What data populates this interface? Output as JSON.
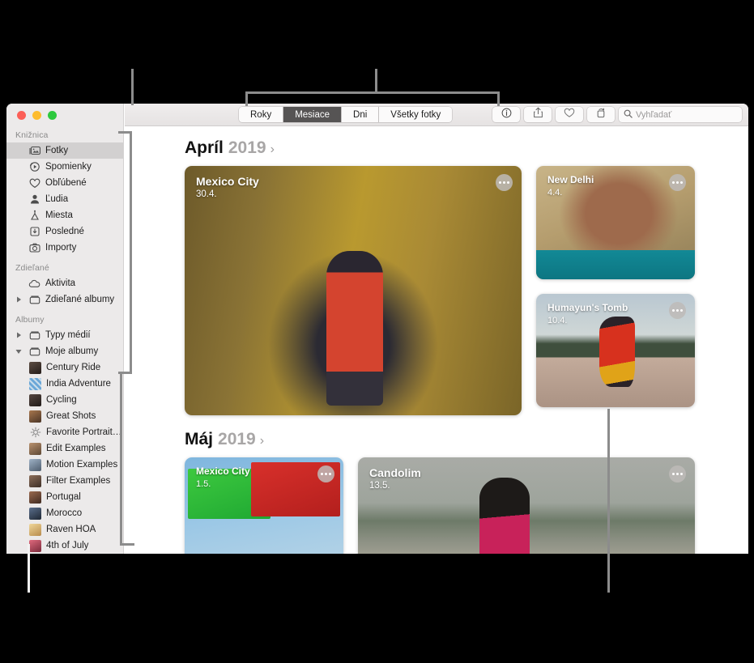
{
  "window": {
    "traffic_lights": [
      "close",
      "minimize",
      "zoom"
    ]
  },
  "sidebar": {
    "sections": [
      {
        "header": "Knižnica",
        "items": [
          {
            "label": "Fotky",
            "icon": "photos-icon",
            "selected": true
          },
          {
            "label": "Spomienky",
            "icon": "memories-icon",
            "selected": false
          },
          {
            "label": "Obľúbené",
            "icon": "heart-icon",
            "selected": false
          },
          {
            "label": "Ľudia",
            "icon": "person-icon",
            "selected": false
          },
          {
            "label": "Miesta",
            "icon": "map-pin-icon",
            "selected": false
          },
          {
            "label": "Posledné",
            "icon": "recents-icon",
            "selected": false
          },
          {
            "label": "Importy",
            "icon": "camera-icon",
            "selected": false
          }
        ]
      },
      {
        "header": "Zdieľané",
        "items": [
          {
            "label": "Aktivita",
            "icon": "cloud-icon",
            "selected": false
          },
          {
            "label": "Zdieľané albumy",
            "icon": "folder-icon",
            "selected": false,
            "disclosure": "collapsed"
          }
        ]
      },
      {
        "header": "Albumy",
        "items": [
          {
            "label": "Typy médií",
            "icon": "folder-icon",
            "selected": false,
            "disclosure": "collapsed"
          },
          {
            "label": "Moje albumy",
            "icon": "folder-icon",
            "selected": false,
            "disclosure": "expanded"
          }
        ]
      }
    ],
    "albums": [
      {
        "label": "Century Ride",
        "thumb": "#3d3330"
      },
      {
        "label": "India Adventure",
        "thumb": "#5a8ec4"
      },
      {
        "label": "Cycling",
        "thumb": "#3b3230"
      },
      {
        "label": "Great Shots",
        "thumb": "#7b5a3e"
      },
      {
        "label": "Favorite Portrait…",
        "thumb": "none",
        "icon": "smart-album-icon"
      },
      {
        "label": "Edit Examples",
        "thumb": "#8f7159"
      },
      {
        "label": "Motion Examples",
        "thumb": "#6f8096"
      },
      {
        "label": "Filter Examples",
        "thumb": "#6b5548"
      },
      {
        "label": "Portugal",
        "thumb": "#6e4c3c"
      },
      {
        "label": "Morocco",
        "thumb": "#3f4f6b"
      },
      {
        "label": "Raven HOA",
        "thumb": "#d8b87f"
      },
      {
        "label": "4th of July",
        "thumb": "#b2495a"
      }
    ]
  },
  "toolbar": {
    "segments": [
      {
        "label": "Roky",
        "selected": false
      },
      {
        "label": "Mesiace",
        "selected": true
      },
      {
        "label": "Dni",
        "selected": false
      },
      {
        "label": "Všetky fotky",
        "selected": false
      }
    ],
    "buttons": [
      {
        "name": "info-icon",
        "glyph": "info"
      },
      {
        "name": "share-icon",
        "glyph": "share"
      },
      {
        "name": "favorite-icon",
        "glyph": "heart"
      },
      {
        "name": "rotate-icon",
        "glyph": "rotate"
      }
    ],
    "search": {
      "placeholder": "Vyhľadať",
      "value": "",
      "icon": "search-icon"
    }
  },
  "content": {
    "groups": [
      {
        "month": "Apríl",
        "year": "2019",
        "chevron": "›",
        "main": {
          "title": "Mexico City",
          "date": "30.4.",
          "photo": "ph-mexico"
        },
        "side": [
          {
            "title": "New Delhi",
            "date": "4.4.",
            "photo": "ph-delhi"
          },
          {
            "title": "Humayun's Tomb",
            "date": "10.4.",
            "photo": "ph-tomb"
          }
        ]
      },
      {
        "month": "Máj",
        "year": "2019",
        "chevron": "›",
        "main": {
          "title": "Mexico City",
          "date": "1.5.",
          "photo": "ph-papel"
        },
        "side": [
          {
            "title": "Candolim",
            "date": "13.5.",
            "photo": "ph-candolim"
          }
        ]
      }
    ]
  },
  "colors": {
    "callout_line": "#8c8c8c",
    "callout_line_white": "#f2f2f2",
    "backdrop": "#000000",
    "sidebar_bg": "#eceaea",
    "selection": "#d2d0d0",
    "segment_selected": "#565454",
    "year_text": "#a8a6a6"
  }
}
